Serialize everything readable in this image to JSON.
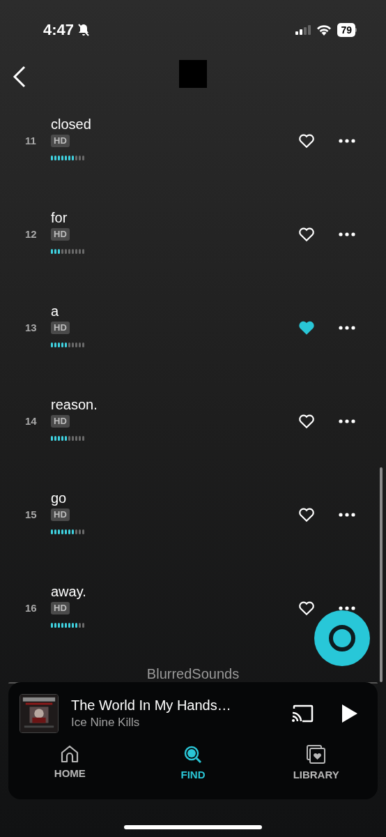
{
  "status_bar": {
    "time": "4:47",
    "battery": "79"
  },
  "tracks": [
    {
      "number": "11",
      "title": "closed",
      "badge": "HD",
      "level": 0.7,
      "liked": false
    },
    {
      "number": "12",
      "title": "for",
      "badge": "HD",
      "level": 0.3,
      "liked": false
    },
    {
      "number": "13",
      "title": "a",
      "badge": "HD",
      "level": 0.5,
      "liked": true
    },
    {
      "number": "14",
      "title": "reason.",
      "badge": "HD",
      "level": 0.5,
      "liked": false
    },
    {
      "number": "15",
      "title": "go",
      "badge": "HD",
      "level": 0.7,
      "liked": false
    },
    {
      "number": "16",
      "title": "away.",
      "badge": "HD",
      "level": 0.8,
      "liked": false
    }
  ],
  "footer_label": "BlurredSounds",
  "now_playing": {
    "title": "The World In My Hands…",
    "artist": "Ice Nine Kills"
  },
  "nav": [
    {
      "label": "HOME",
      "kind": "home",
      "selected": false
    },
    {
      "label": "FIND",
      "kind": "find",
      "selected": true
    },
    {
      "label": "LIBRARY",
      "kind": "library",
      "selected": false
    }
  ]
}
